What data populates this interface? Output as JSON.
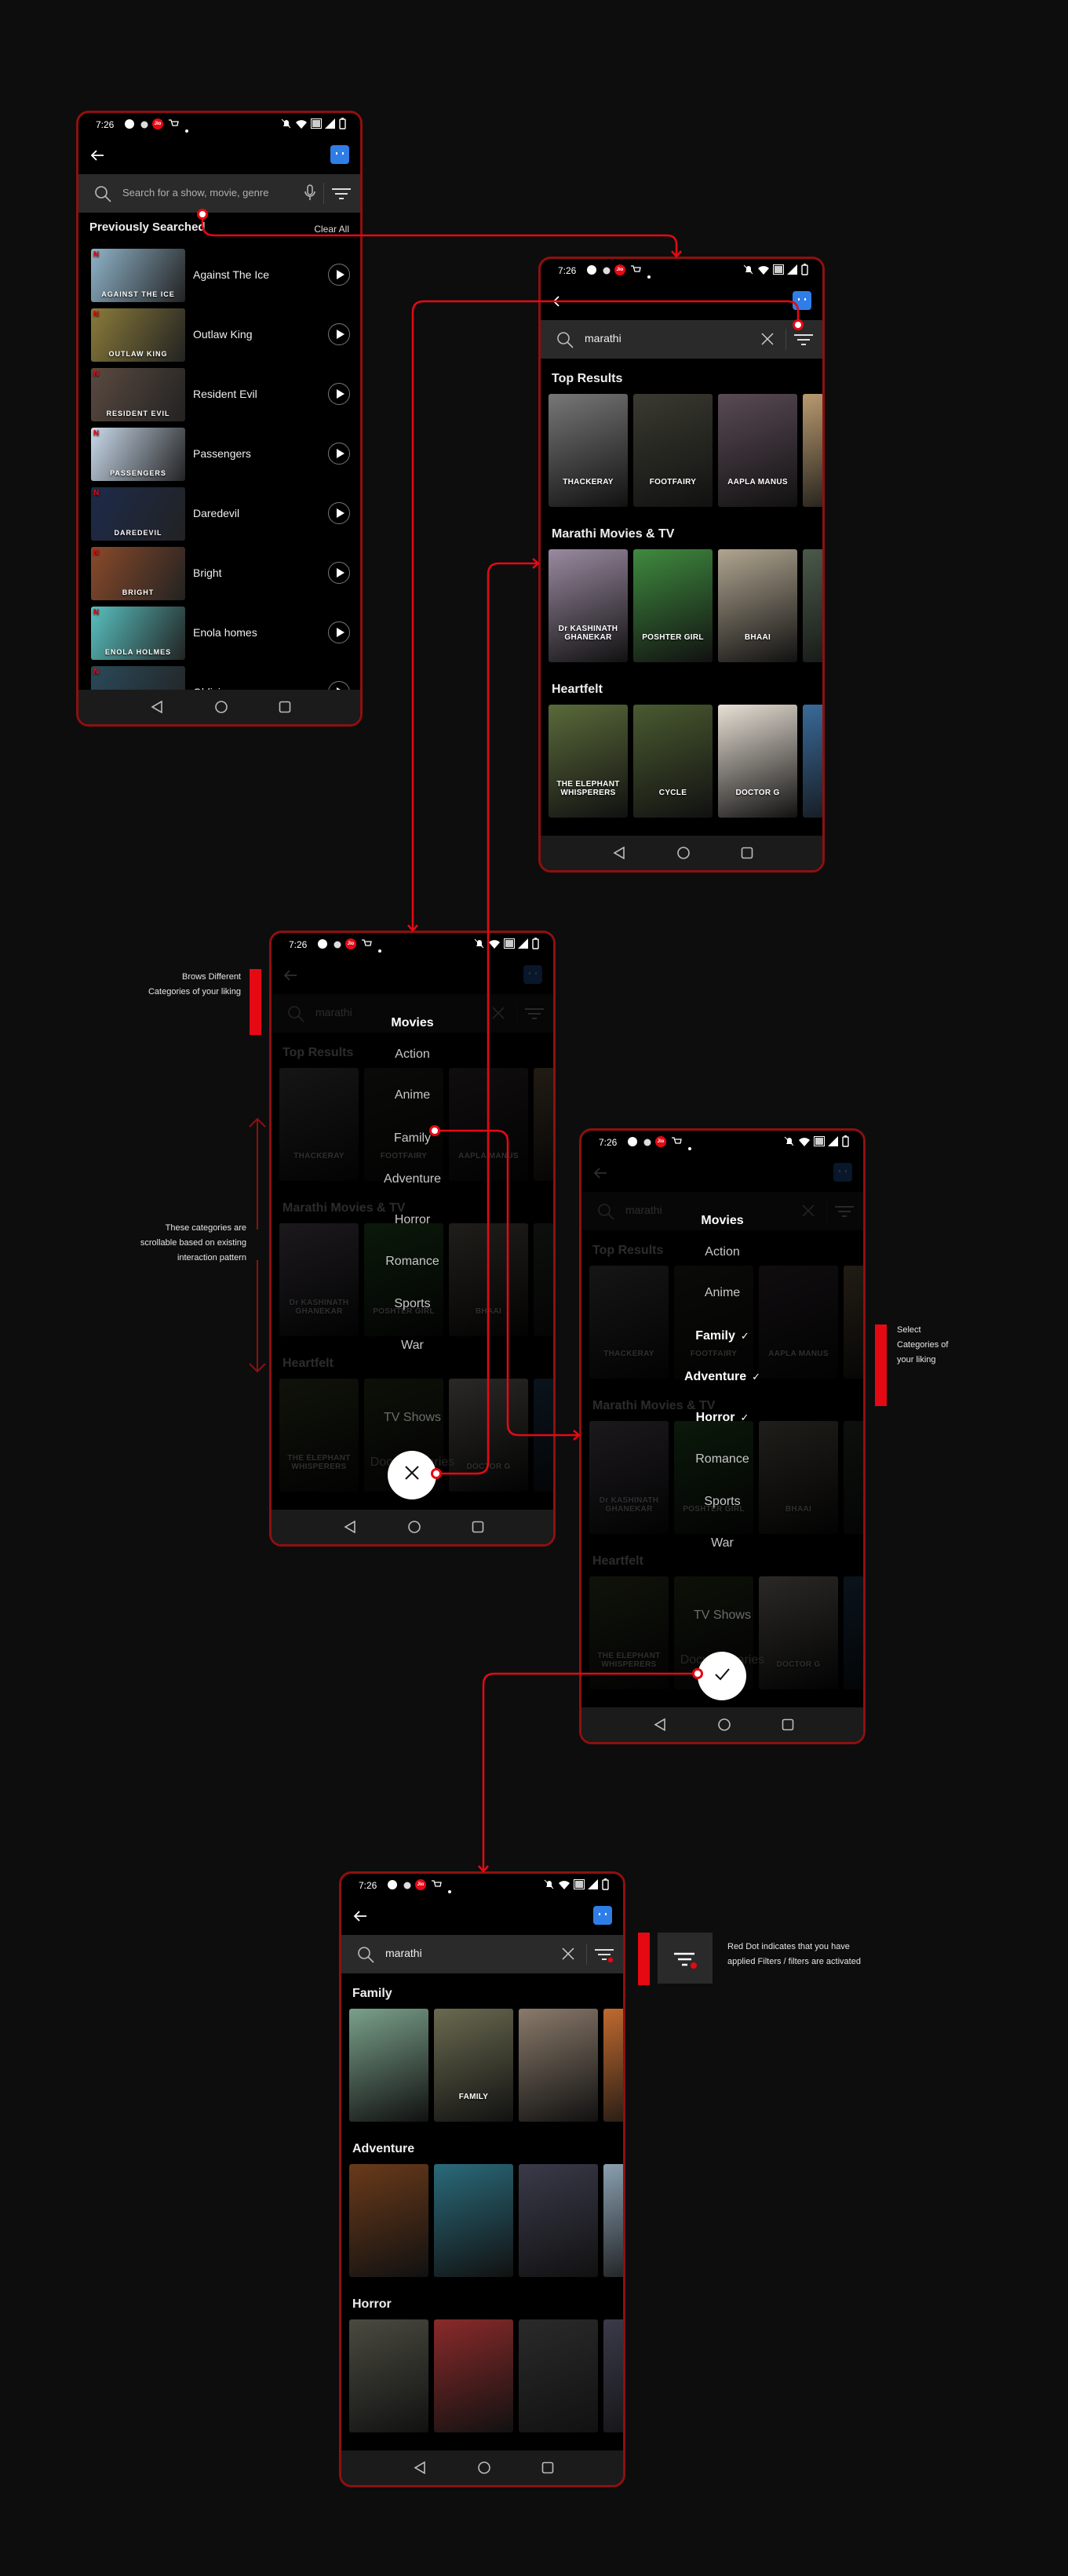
{
  "colors": {
    "accent": "#e50914",
    "frame": "#8e1010",
    "profile": "#2f7ee8",
    "background": "#0d0d0d"
  },
  "status": {
    "time": "7:26",
    "carrier": "Jio"
  },
  "screen1": {
    "search_placeholder": "Search for a show, movie, genre",
    "section_title": "Previously Searched",
    "clear_all": "Clear All",
    "items": [
      {
        "title": "Against The Ice",
        "art": "AGAINST THE ICE",
        "tone": "#8fb3c9"
      },
      {
        "title": "Outlaw King",
        "art": "OUTLAW KING",
        "tone": "#8a7b3a"
      },
      {
        "title": "Resident Evil",
        "art": "RESIDENT EVIL",
        "tone": "#5a4a40"
      },
      {
        "title": "Passengers",
        "art": "PASSENGERS",
        "tone": "#c9d9ea"
      },
      {
        "title": "Daredevil",
        "art": "DAREDEVIL",
        "tone": "#1d2a4a"
      },
      {
        "title": "Bright",
        "art": "BRIGHT",
        "tone": "#8a4a2a"
      },
      {
        "title": "Enola homes",
        "art": "ENOLA HOLMES",
        "tone": "#59c0c0"
      },
      {
        "title": "Oblivion",
        "art": "",
        "tone": "#2a4a5a"
      }
    ]
  },
  "screen2": {
    "search_value": "marathi",
    "rows": [
      {
        "title": "Top Results",
        "posters": [
          {
            "art": "THACKERAY",
            "tone": "#777777"
          },
          {
            "art": "FOOTFAIRY",
            "tone": "#3a3a30"
          },
          {
            "art": "AAPLA MANUS",
            "tone": "#5a4a55"
          },
          {
            "art": "",
            "tone": "#b89a70"
          }
        ]
      },
      {
        "title": "Marathi Movies & TV",
        "posters": [
          {
            "art": "Dr KASHINATH GHANEKAR",
            "tone": "#9a8aa0"
          },
          {
            "art": "POSHTER GIRL",
            "tone": "#3f8a3f"
          },
          {
            "art": "BHAAI",
            "tone": "#b0a590"
          },
          {
            "art": "",
            "tone": "#4a5a4a"
          }
        ]
      },
      {
        "title": "Heartfelt",
        "posters": [
          {
            "art": "THE ELEPHANT WHISPERERS",
            "tone": "#5a6a3a"
          },
          {
            "art": "CYCLE",
            "tone": "#4a5a30"
          },
          {
            "art": "DOCTOR G",
            "tone": "#e8e0d5"
          },
          {
            "art": "",
            "tone": "#3a6a9a"
          }
        ]
      }
    ]
  },
  "menu": {
    "title": "Movies",
    "items": [
      "Action",
      "Anime",
      "Family",
      "Adventure",
      "Horror",
      "Romance",
      "Sports",
      "War",
      "TV Shows",
      "Documentaries"
    ],
    "selected_in_screen4": [
      "Family",
      "Adventure",
      "Horror"
    ],
    "close_icon": "close-icon",
    "confirm_icon": "check-icon"
  },
  "screen5": {
    "search_value": "marathi",
    "filter_active": true,
    "rows": [
      {
        "title": "Family",
        "posters": [
          {
            "art": "",
            "tone": "#7aa08a"
          },
          {
            "art": "FAMILY",
            "tone": "#6a6a50"
          },
          {
            "art": "",
            "tone": "#8a7a6a"
          },
          {
            "art": "",
            "tone": "#c06a30"
          }
        ]
      },
      {
        "title": "Adventure",
        "posters": [
          {
            "art": "",
            "tone": "#6a3a1a"
          },
          {
            "art": "",
            "tone": "#2a6a7a"
          },
          {
            "art": "",
            "tone": "#3a3a4a"
          },
          {
            "art": "",
            "tone": "#8aa0b0"
          }
        ]
      },
      {
        "title": "Horror",
        "posters": [
          {
            "art": "",
            "tone": "#4a4a40"
          },
          {
            "art": "",
            "tone": "#8a2a2a"
          },
          {
            "art": "",
            "tone": "#2a2a2a"
          },
          {
            "art": "",
            "tone": "#3a3a4a"
          }
        ]
      }
    ]
  },
  "notes": {
    "browse": [
      "Brows Different",
      "Categories of your liking"
    ],
    "scroll": [
      "These categories are",
      "scrollable based on existing",
      "interaction pattern"
    ],
    "select": [
      "Select",
      "Categories of",
      "your liking"
    ],
    "red_dot": [
      "Red Dot indicates that you have",
      "applied Filters / filters are activated"
    ]
  }
}
